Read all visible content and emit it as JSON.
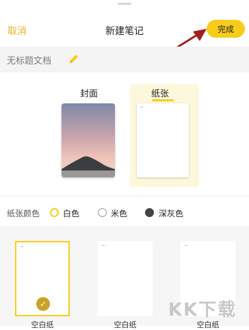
{
  "header": {
    "cancel_label": "取消",
    "title": "新建笔记",
    "done_label": "完成"
  },
  "doc": {
    "name": "无标题文档",
    "edit_icon": "pencil-icon"
  },
  "options": {
    "cover_label": "封面",
    "paper_label": "纸张"
  },
  "paper_color": {
    "label": "纸张颜色",
    "options": [
      {
        "label": "白色",
        "selected": true
      },
      {
        "label": "米色",
        "selected": false
      },
      {
        "label": "深灰色",
        "selected": false
      }
    ]
  },
  "templates": {
    "items": [
      {
        "label": "空白纸",
        "selected": true
      },
      {
        "label": "空白纸",
        "selected": false
      },
      {
        "label": "空白纸",
        "selected": false
      }
    ]
  },
  "watermark": "KK下载",
  "colors": {
    "accent": "#f7cd19",
    "cancel": "#e0b820",
    "annotation_arrow": "#a31f1f"
  }
}
